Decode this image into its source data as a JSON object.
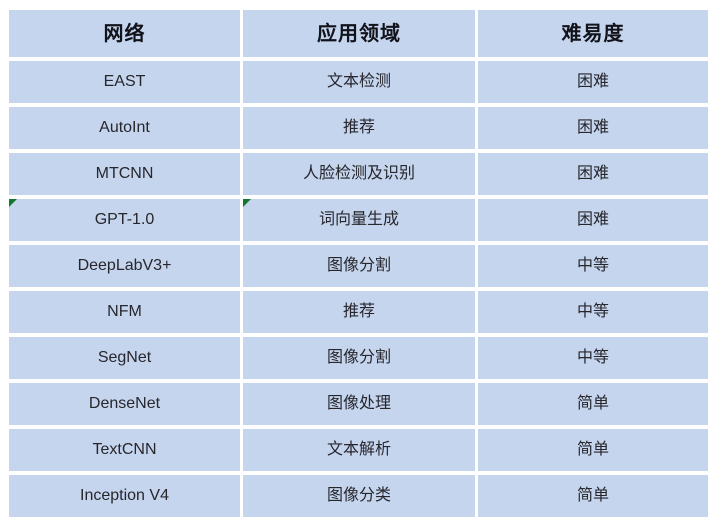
{
  "table": {
    "name": "neural-network-overview-table",
    "columns": [
      {
        "key": "network",
        "label": "网络"
      },
      {
        "key": "domain",
        "label": "应用领域"
      },
      {
        "key": "level",
        "label": "难易度"
      }
    ],
    "rows": [
      {
        "network": "EAST",
        "domain": "文本检测",
        "level": "困难"
      },
      {
        "network": "AutoInt",
        "domain": "推荐",
        "level": "困难"
      },
      {
        "network": "MTCNN",
        "domain": "人脸检测及识别",
        "level": "困难"
      },
      {
        "network": "GPT-1.0",
        "domain": "词向量生成",
        "level": "困难"
      },
      {
        "network": "DeepLabV3+",
        "domain": "图像分割",
        "level": "中等"
      },
      {
        "network": "NFM",
        "domain": "推荐",
        "level": "中等"
      },
      {
        "network": "SegNet",
        "domain": "图像分割",
        "level": "中等"
      },
      {
        "network": "DenseNet",
        "domain": "图像处理",
        "level": "简单"
      },
      {
        "network": "TextCNN",
        "domain": "文本解析",
        "level": "简单"
      },
      {
        "network": "Inception V4",
        "domain": "图像分类",
        "level": "简单"
      }
    ],
    "comment_markers": [
      {
        "row_index": 3,
        "column_key": "network",
        "icon": "comment-triangle-icon"
      },
      {
        "row_index": 3,
        "column_key": "domain",
        "icon": "comment-triangle-icon"
      }
    ]
  },
  "colors": {
    "cell_fill": "#c5d5ee",
    "page_background": "#ffffff",
    "header_text": "#11121a",
    "body_text": "#26262c",
    "comment_marker": "#12782e"
  }
}
